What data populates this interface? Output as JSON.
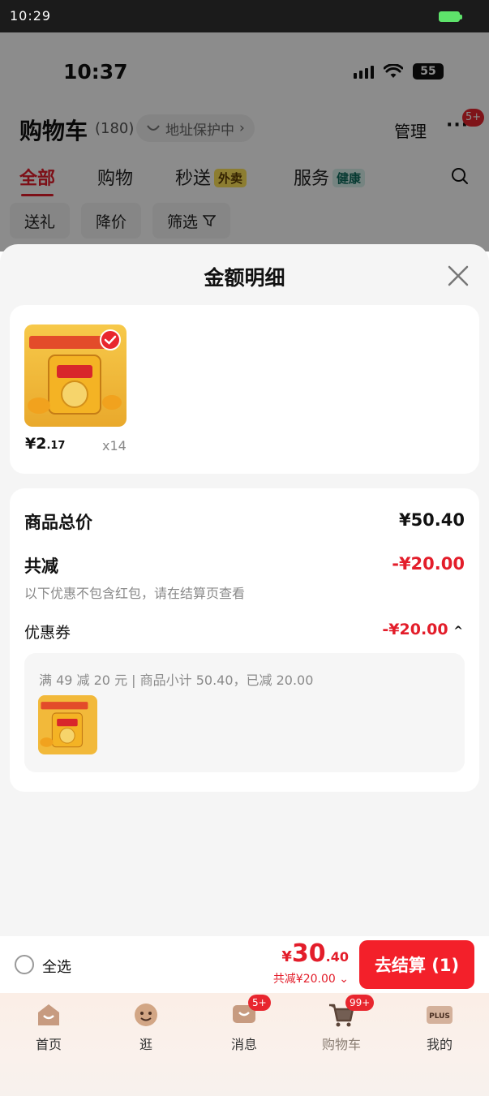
{
  "outer_status": {
    "time": "10:29"
  },
  "inner_status": {
    "time": "10:37",
    "battery": "55"
  },
  "header": {
    "title": "购物车",
    "count": "(180)",
    "address_pill": "地址保护中",
    "manage": "管理",
    "more_badge": "5+"
  },
  "tabs": [
    {
      "label": "全部"
    },
    {
      "label": "购物"
    },
    {
      "label": "秒送",
      "tag": "外卖"
    },
    {
      "label": "服务",
      "tag": "健康"
    }
  ],
  "chips": [
    {
      "label": "送礼"
    },
    {
      "label": "降价"
    },
    {
      "label": "筛选"
    }
  ],
  "sheet": {
    "title": "金额明细",
    "item": {
      "price_int": "¥2",
      "price_dec": ".17",
      "qty": "x14"
    },
    "rows": {
      "subtotal_label": "商品总价",
      "subtotal_value": "¥50.40",
      "discount_label": "共减",
      "discount_value": "-¥20.00",
      "discount_note": "以下优惠不包含红包，请在结算页查看",
      "coupon_label": "优惠券",
      "coupon_value": "-¥20.00"
    },
    "coupon_desc": "满 49 减 20 元 | 商品小计 50.40，已减 20.00"
  },
  "checkout": {
    "select_all": "全选",
    "total_currency": "¥",
    "total_int": "30",
    "total_dec": ".40",
    "saved": "共减¥20.00",
    "pay_button": "去结算 (1)"
  },
  "tabbar": [
    {
      "label": "首页"
    },
    {
      "label": "逛"
    },
    {
      "label": "消息",
      "badge": "5+"
    },
    {
      "label": "购物车",
      "badge": "99+"
    },
    {
      "label": "我的",
      "icon_text": "PLUS"
    }
  ],
  "colors": {
    "accent": "#e31d2a",
    "button": "#f3202a",
    "sheet_bg": "#f5f5f5"
  }
}
